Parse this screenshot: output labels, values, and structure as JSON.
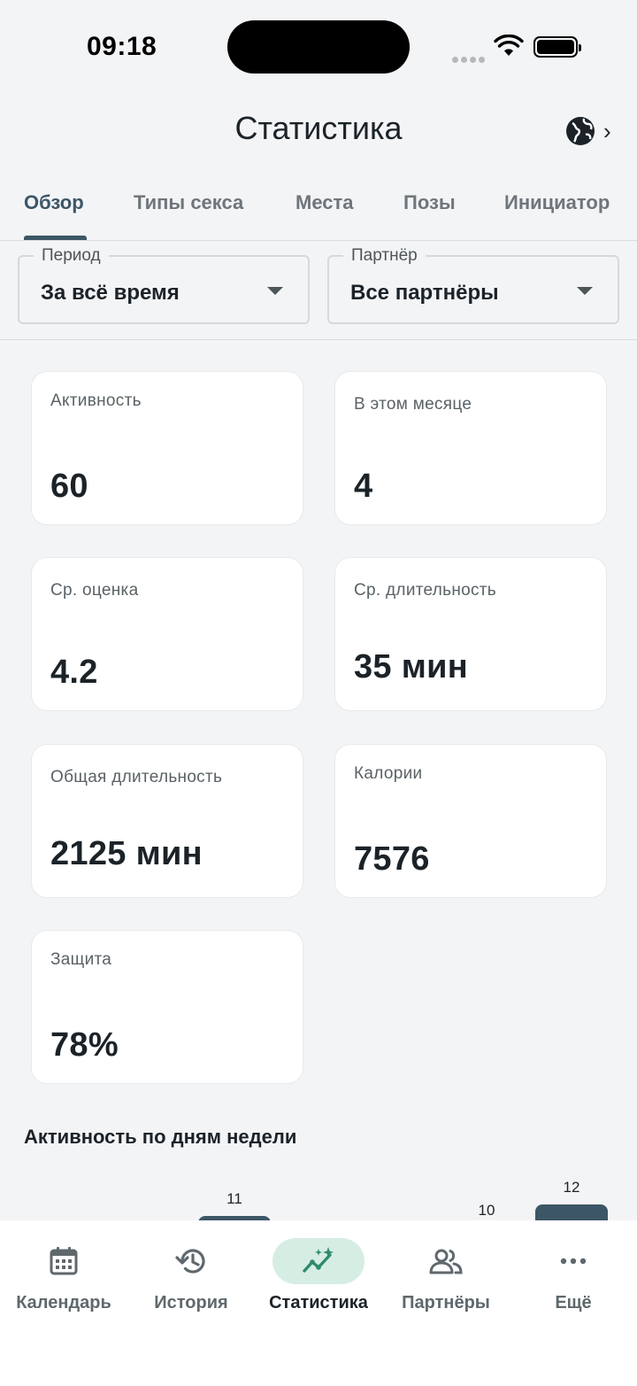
{
  "status_bar": {
    "time": "09:18"
  },
  "header": {
    "title": "Статистика"
  },
  "tabs": [
    {
      "label": "Обзор",
      "active": true
    },
    {
      "label": "Типы секса",
      "active": false
    },
    {
      "label": "Места",
      "active": false
    },
    {
      "label": "Позы",
      "active": false
    },
    {
      "label": "Инициатор",
      "active": false
    }
  ],
  "filters": {
    "period": {
      "label": "Период",
      "value": "За всё время"
    },
    "partner": {
      "label": "Партнёр",
      "value": "Все партнёры"
    }
  },
  "stats": [
    {
      "label": "Активность",
      "value": "60"
    },
    {
      "label": "В этом месяце",
      "value": "4"
    },
    {
      "label": "Ср. оценка",
      "value": "4.2"
    },
    {
      "label": "Ср. длительность",
      "value": "35 мин"
    },
    {
      "label": "Общая длительность",
      "value": "2125 мин"
    },
    {
      "label": "Калории",
      "value": "7576"
    },
    {
      "label": "Защита",
      "value": "78%"
    }
  ],
  "weekday_chart": {
    "title": "Активность по дням недели",
    "chart_data": {
      "type": "bar",
      "visible_values": [
        11,
        10,
        12
      ]
    }
  },
  "bottom_nav": [
    {
      "label": "Календарь",
      "icon": "calendar-icon",
      "active": false
    },
    {
      "label": "История",
      "icon": "history-icon",
      "active": false
    },
    {
      "label": "Статистика",
      "icon": "stats-icon",
      "active": true
    },
    {
      "label": "Партнёры",
      "icon": "partners-icon",
      "active": false
    },
    {
      "label": "Ещё",
      "icon": "more-icon",
      "active": false
    }
  ],
  "colors": {
    "accent": "#3c5666",
    "active_nav_bg": "#d6ede4",
    "active_nav_icon": "#2e8a6e",
    "background": "#f3f4f6"
  }
}
